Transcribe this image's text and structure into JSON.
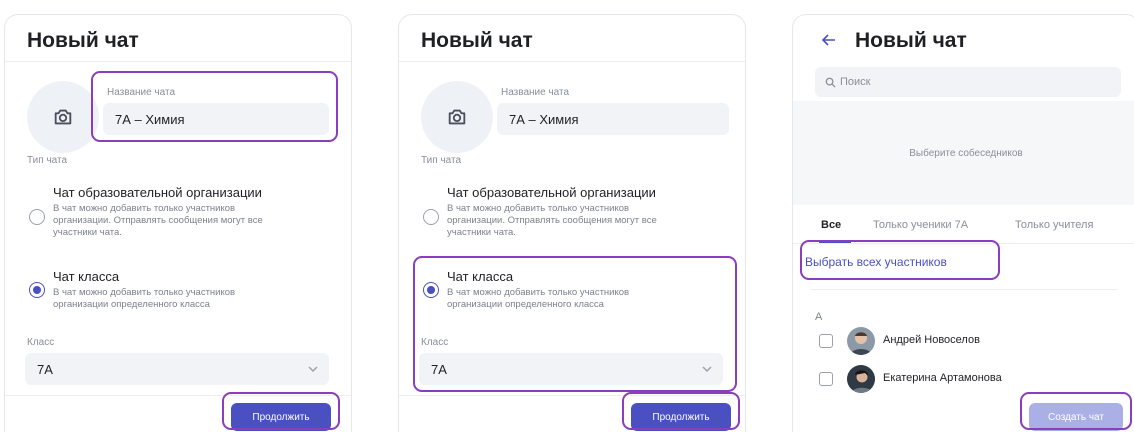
{
  "screens": [
    {
      "title": "Новый чат",
      "chat_name_label": "Название чата",
      "chat_name_value": "7А – Химия",
      "chat_type_label": "Тип чата",
      "options": [
        {
          "title": "Чат образовательной организации",
          "desc": "В чат можно добавить только участников организации. Отправлять сообщения могут все участники чата.",
          "checked": false
        },
        {
          "title": "Чат класса",
          "desc": "В чат можно добавить только участников организации определенного класса",
          "checked": true
        }
      ],
      "class_label": "Класс",
      "class_value": "7А",
      "continue_label": "Продолжить"
    },
    {
      "title": "Новый чат",
      "chat_name_label": "Название чата",
      "chat_name_value": "7А – Химия",
      "chat_type_label": "Тип чата",
      "options": [
        {
          "title": "Чат образовательной организации",
          "desc": "В чат можно добавить только участников организации. Отправлять сообщения могут все участники чата.",
          "checked": false
        },
        {
          "title": "Чат класса",
          "desc": "В чат можно добавить только участников организации определенного класса",
          "checked": true
        }
      ],
      "class_label": "Класс",
      "class_value": "7А",
      "continue_label": "Продолжить"
    },
    {
      "title": "Новый чат",
      "search_placeholder": "Поиск",
      "empty_text": "Выберите собеседников",
      "tabs": [
        "Все",
        "Только ученики 7А",
        "Только учителя"
      ],
      "select_all_label": "Выбрать всех участников",
      "letter": "А",
      "contacts": [
        {
          "name": "Андрей Новоселов"
        },
        {
          "name": "Екатерина Артамонова"
        }
      ],
      "create_label": "Создать чат"
    }
  ],
  "colors": {
    "accent": "#4a4fc1",
    "highlight": "#8a3dbd",
    "disabled": "#aab0e6"
  }
}
